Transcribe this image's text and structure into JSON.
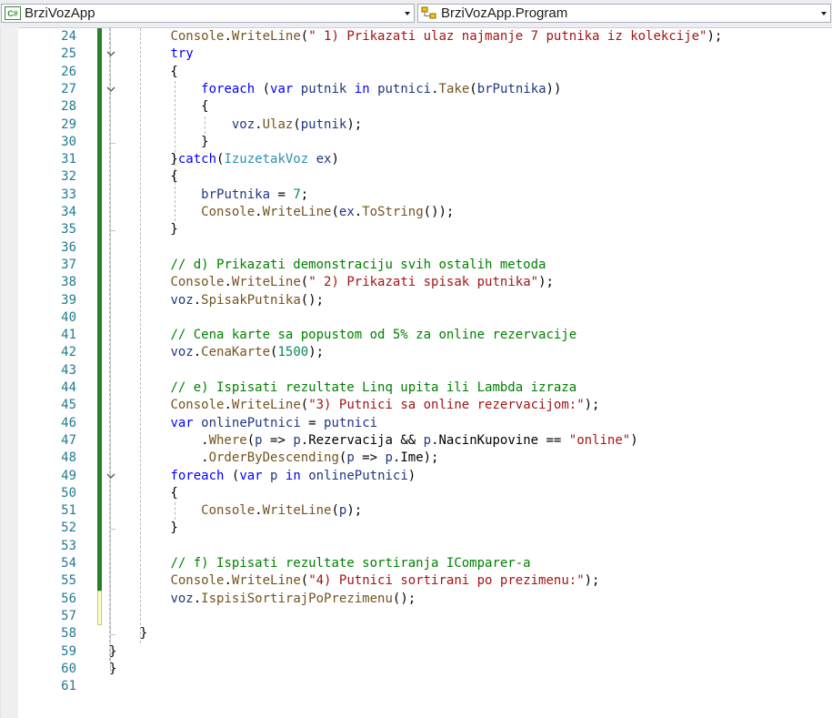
{
  "navbar": {
    "project": {
      "label": "BrziVozApp",
      "icon": "csharp-project-icon",
      "icon_text": "C#"
    },
    "class": {
      "label": "BrziVozApp.Program",
      "icon": "class-icon"
    }
  },
  "colors": {
    "line_number": "#237893",
    "keyword": "#0000ff",
    "string": "#a31515",
    "comment": "#008000",
    "type": "#2b91af",
    "method": "#74531f",
    "variable": "#1f377f",
    "number": "#098658",
    "changed_saved": "#288028",
    "changed_unsaved": "#fdfdc8"
  },
  "editor": {
    "lines": [
      {
        "n": "24",
        "tokens": [
          [
            "t",
            "        "
          ],
          [
            "m",
            "Console"
          ],
          [
            "t",
            "."
          ],
          [
            "m",
            "WriteLine"
          ],
          [
            "t",
            "("
          ],
          [
            "s",
            "\" 1) Prikazati ulaz najmanje 7 putnika iz kolekcije\""
          ],
          [
            "t",
            ");"
          ]
        ]
      },
      {
        "n": "25",
        "tokens": [
          [
            "t",
            "        "
          ],
          [
            "k",
            "try"
          ]
        ]
      },
      {
        "n": "26",
        "tokens": [
          [
            "t",
            "        {"
          ]
        ]
      },
      {
        "n": "27",
        "tokens": [
          [
            "t",
            "            "
          ],
          [
            "k",
            "foreach"
          ],
          [
            "t",
            " ("
          ],
          [
            "k",
            "var"
          ],
          [
            "t",
            " "
          ],
          [
            "v",
            "putnik"
          ],
          [
            "t",
            " "
          ],
          [
            "k",
            "in"
          ],
          [
            "t",
            " "
          ],
          [
            "v",
            "putnici"
          ],
          [
            "t",
            "."
          ],
          [
            "m",
            "Take"
          ],
          [
            "t",
            "("
          ],
          [
            "v",
            "brPutnika"
          ],
          [
            "t",
            "))"
          ]
        ]
      },
      {
        "n": "28",
        "tokens": [
          [
            "t",
            "            {"
          ]
        ]
      },
      {
        "n": "29",
        "tokens": [
          [
            "t",
            "                "
          ],
          [
            "v",
            "voz"
          ],
          [
            "t",
            "."
          ],
          [
            "m",
            "Ulaz"
          ],
          [
            "t",
            "("
          ],
          [
            "v",
            "putnik"
          ],
          [
            "t",
            ");"
          ]
        ]
      },
      {
        "n": "30",
        "tokens": [
          [
            "t",
            "            }"
          ]
        ]
      },
      {
        "n": "31",
        "tokens": [
          [
            "t",
            "        }"
          ],
          [
            "k",
            "catch"
          ],
          [
            "t",
            "("
          ],
          [
            "y",
            "IzuzetakVoz"
          ],
          [
            "t",
            " "
          ],
          [
            "v",
            "ex"
          ],
          [
            "t",
            ")"
          ]
        ]
      },
      {
        "n": "32",
        "tokens": [
          [
            "t",
            "        {"
          ]
        ]
      },
      {
        "n": "33",
        "tokens": [
          [
            "t",
            "            "
          ],
          [
            "v",
            "brPutnika"
          ],
          [
            "t",
            " = "
          ],
          [
            "u",
            "7"
          ],
          [
            "t",
            ";"
          ]
        ]
      },
      {
        "n": "34",
        "tokens": [
          [
            "t",
            "            "
          ],
          [
            "m",
            "Console"
          ],
          [
            "t",
            "."
          ],
          [
            "m",
            "WriteLine"
          ],
          [
            "t",
            "("
          ],
          [
            "v",
            "ex"
          ],
          [
            "t",
            "."
          ],
          [
            "m",
            "ToString"
          ],
          [
            "t",
            "());"
          ]
        ]
      },
      {
        "n": "35",
        "tokens": [
          [
            "t",
            "        }"
          ]
        ]
      },
      {
        "n": "36",
        "tokens": []
      },
      {
        "n": "37",
        "tokens": [
          [
            "t",
            "        "
          ],
          [
            "c",
            "// d) Prikazati demonstraciju svih ostalih metoda"
          ]
        ]
      },
      {
        "n": "38",
        "tokens": [
          [
            "t",
            "        "
          ],
          [
            "m",
            "Console"
          ],
          [
            "t",
            "."
          ],
          [
            "m",
            "WriteLine"
          ],
          [
            "t",
            "("
          ],
          [
            "s",
            "\" 2) Prikazati spisak putnika\""
          ],
          [
            "t",
            ");"
          ]
        ]
      },
      {
        "n": "39",
        "tokens": [
          [
            "t",
            "        "
          ],
          [
            "v",
            "voz"
          ],
          [
            "t",
            "."
          ],
          [
            "m",
            "SpisakPutnika"
          ],
          [
            "t",
            "();"
          ]
        ]
      },
      {
        "n": "40",
        "tokens": []
      },
      {
        "n": "41",
        "tokens": [
          [
            "t",
            "        "
          ],
          [
            "c",
            "// Cena karte sa popustom od 5% za online rezervacije"
          ]
        ]
      },
      {
        "n": "42",
        "tokens": [
          [
            "t",
            "        "
          ],
          [
            "v",
            "voz"
          ],
          [
            "t",
            "."
          ],
          [
            "m",
            "CenaKarte"
          ],
          [
            "t",
            "("
          ],
          [
            "u",
            "1500"
          ],
          [
            "t",
            ");"
          ]
        ]
      },
      {
        "n": "43",
        "tokens": []
      },
      {
        "n": "44",
        "tokens": [
          [
            "t",
            "        "
          ],
          [
            "c",
            "// e) Ispisati rezultate Linq upita ili Lambda izraza"
          ]
        ]
      },
      {
        "n": "45",
        "tokens": [
          [
            "t",
            "        "
          ],
          [
            "m",
            "Console"
          ],
          [
            "t",
            "."
          ],
          [
            "m",
            "WriteLine"
          ],
          [
            "t",
            "("
          ],
          [
            "s",
            "\"3) Putnici sa online rezervacijom:\""
          ],
          [
            "t",
            ");"
          ]
        ]
      },
      {
        "n": "46",
        "tokens": [
          [
            "t",
            "        "
          ],
          [
            "k",
            "var"
          ],
          [
            "t",
            " "
          ],
          [
            "v",
            "onlinePutnici"
          ],
          [
            "t",
            " = "
          ],
          [
            "v",
            "putnici"
          ]
        ]
      },
      {
        "n": "47",
        "tokens": [
          [
            "t",
            "            ."
          ],
          [
            "m",
            "Where"
          ],
          [
            "t",
            "("
          ],
          [
            "v",
            "p"
          ],
          [
            "t",
            " => "
          ],
          [
            "v",
            "p"
          ],
          [
            "t",
            ".Rezervacija && "
          ],
          [
            "v",
            "p"
          ],
          [
            "t",
            ".NacinKupovine == "
          ],
          [
            "s",
            "\"online\""
          ],
          [
            "t",
            ")"
          ]
        ]
      },
      {
        "n": "48",
        "tokens": [
          [
            "t",
            "            ."
          ],
          [
            "m",
            "OrderByDescending"
          ],
          [
            "t",
            "("
          ],
          [
            "v",
            "p"
          ],
          [
            "t",
            " => "
          ],
          [
            "v",
            "p"
          ],
          [
            "t",
            ".Ime);"
          ]
        ]
      },
      {
        "n": "49",
        "tokens": [
          [
            "t",
            "        "
          ],
          [
            "k",
            "foreach"
          ],
          [
            "t",
            " ("
          ],
          [
            "k",
            "var"
          ],
          [
            "t",
            " "
          ],
          [
            "v",
            "p"
          ],
          [
            "t",
            " "
          ],
          [
            "k",
            "in"
          ],
          [
            "t",
            " "
          ],
          [
            "v",
            "onlinePutnici"
          ],
          [
            "t",
            ")"
          ]
        ]
      },
      {
        "n": "50",
        "tokens": [
          [
            "t",
            "        {"
          ]
        ]
      },
      {
        "n": "51",
        "tokens": [
          [
            "t",
            "            "
          ],
          [
            "m",
            "Console"
          ],
          [
            "t",
            "."
          ],
          [
            "m",
            "WriteLine"
          ],
          [
            "t",
            "("
          ],
          [
            "v",
            "p"
          ],
          [
            "t",
            ");"
          ]
        ]
      },
      {
        "n": "52",
        "tokens": [
          [
            "t",
            "        }"
          ]
        ]
      },
      {
        "n": "53",
        "tokens": []
      },
      {
        "n": "54",
        "tokens": [
          [
            "t",
            "        "
          ],
          [
            "c",
            "// f) Ispisati rezultate sortiranja IComparer-a"
          ]
        ]
      },
      {
        "n": "55",
        "tokens": [
          [
            "t",
            "        "
          ],
          [
            "m",
            "Console"
          ],
          [
            "t",
            "."
          ],
          [
            "m",
            "WriteLine"
          ],
          [
            "t",
            "("
          ],
          [
            "s",
            "\"4) Putnici sortirani po prezimenu:\""
          ],
          [
            "t",
            ");"
          ]
        ]
      },
      {
        "n": "56",
        "tokens": [
          [
            "t",
            "        "
          ],
          [
            "v",
            "voz"
          ],
          [
            "t",
            "."
          ],
          [
            "m",
            "IspisiSortirajPoPrezimenu"
          ],
          [
            "t",
            "();"
          ]
        ]
      },
      {
        "n": "57",
        "tokens": []
      },
      {
        "n": "58",
        "tokens": [
          [
            "t",
            "    }"
          ]
        ]
      },
      {
        "n": "59",
        "tokens": [
          [
            "t",
            "}"
          ]
        ]
      },
      {
        "n": "60",
        "tokens": [
          [
            "t",
            "}"
          ]
        ]
      },
      {
        "n": "61",
        "tokens": []
      }
    ]
  }
}
